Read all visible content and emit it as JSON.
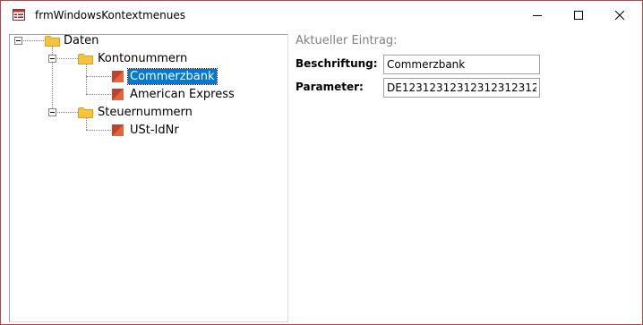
{
  "window": {
    "title": "frmWindowsKontextmenues"
  },
  "tree": {
    "root": {
      "label": "Daten"
    },
    "groups": [
      {
        "label": "Kontonummern",
        "items": [
          {
            "label": "Commerzbank",
            "selected": true
          },
          {
            "label": "American Express",
            "selected": false
          }
        ]
      },
      {
        "label": "Steuernummern",
        "items": [
          {
            "label": "USt-IdNr",
            "selected": false
          }
        ]
      }
    ]
  },
  "details": {
    "section_label": "Aktueller Eintrag:",
    "caption_label": "Beschriftung:",
    "caption_value": "Commerzbank",
    "parameter_label": "Parameter:",
    "parameter_value": "DE12312312312312312312"
  },
  "colors": {
    "selection": "#0078d7",
    "folder": "#f5c342",
    "item_icon": "#c0402a",
    "window_border": "#b04848"
  },
  "icons": {
    "app": "form-icon",
    "minimize": "minimize-icon",
    "maximize": "maximize-icon",
    "close": "close-icon",
    "folder": "folder-icon",
    "item": "item-icon"
  }
}
